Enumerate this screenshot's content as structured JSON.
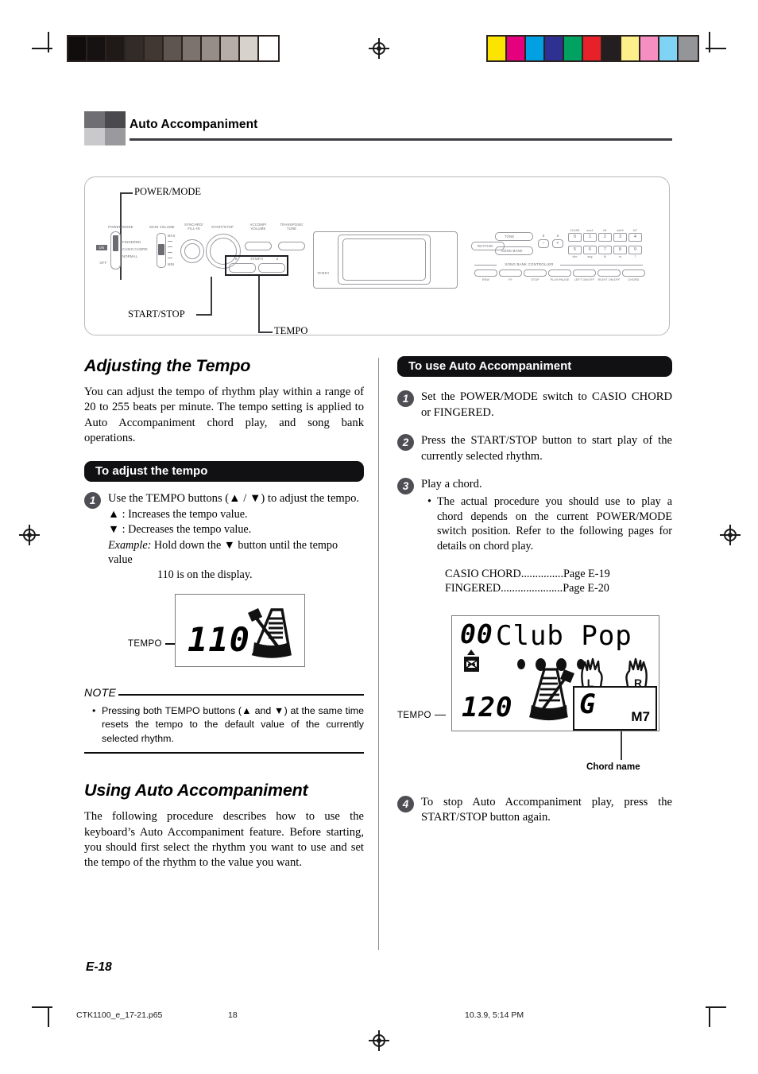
{
  "header": {
    "title": "Auto Accompaniment"
  },
  "panel_figure": {
    "callouts": {
      "power_mode": "POWER/MODE",
      "start_stop": "START/STOP",
      "tempo": "TEMPO"
    },
    "panel_labels": {
      "power_mode": "POWER/MODE",
      "main_volume": "MAIN VOLUME",
      "synchro_fill_in": "SYNCHRO/\nFILL-IN",
      "start_stop": "START/STOP",
      "accomp_volume": "ACCOMP/\nVOLUME",
      "transpose_tune": "TRANSPOSE/\nTUNE",
      "tempo": "TEMPO",
      "tempo_down": "∨",
      "tempo_up": "∧",
      "switch_on": "ON",
      "switch_off": "OFF",
      "mode_fingered": "FINGERED",
      "mode_casio_chord": "CASIO CHORD",
      "mode_normal": "NORMAL",
      "vol_max": "MAX",
      "vol_min": "MIN",
      "lcd_tempo": "TEMPO",
      "rhythm": "RHYTHM",
      "tone": "TONE",
      "song_bank": "SONG BANK",
      "minus": "−",
      "plus": "+",
      "song_bank_controller": "SONG BANK CONTROLLER"
    },
    "numpad_top_labels": [
      "CLEAR",
      "sus4",
      "b5",
      "add9",
      "M7"
    ],
    "numpad_top_keys": [
      "0",
      "1",
      "2",
      "3",
      "4"
    ],
    "numpad_bottom_keys": [
      "5",
      "6",
      "7",
      "8",
      "9"
    ],
    "numpad_bottom_labels": [
      "dim",
      "aug",
      "M",
      "m",
      "7"
    ],
    "controller_buttons": [
      "REW",
      "FF",
      "STOP",
      "PLAY/PAUSE",
      "LEFT ON/OFF",
      "RIGHT ON/OFF",
      "CHORD"
    ]
  },
  "left_column": {
    "heading": "Adjusting the Tempo",
    "intro": "You can adjust the tempo of rhythm play within a range of 20 to 255 beats per minute. The tempo setting is applied to Auto Accompaniment chord play, and song bank operations.",
    "subhead": "To adjust the tempo",
    "step1": {
      "number": "1",
      "text": "Use the TEMPO buttons (▲ / ▼) to adjust the tempo.",
      "line_up": "▲ : Increases the tempo value.",
      "line_down": "▼ : Decreases the tempo value.",
      "example_label": "Example:",
      "example_line1": "Hold down the ▼ button until the tempo value",
      "example_line2": "110 is on the display."
    },
    "tempo_display": {
      "label": "TEMPO",
      "value": "110",
      "icon": "metronome-icon"
    },
    "note": {
      "heading": "NOTE",
      "text": "Pressing both TEMPO buttons (▲ and ▼) at the same time resets the tempo to the default value of the currently selected rhythm."
    },
    "heading2": "Using Auto Accompaniment",
    "intro2": "The following procedure describes how to use the keyboard’s Auto Accompaniment feature. Before starting, you should first select the rhythm you want to use and set the tempo of the rhythm to the value you want."
  },
  "right_column": {
    "subhead": "To use Auto Accompaniment",
    "steps": [
      {
        "number": "1",
        "text": "Set the POWER/MODE switch to CASIO CHORD or FINGERED."
      },
      {
        "number": "2",
        "text": "Press the START/STOP button to start play of the currently selected rhythm."
      },
      {
        "number": "3",
        "text": "Play a chord.",
        "bullet": "The actual procedure you should use to play a chord depends on the current POWER/MODE switch position. Refer to the following pages for details on chord play.",
        "refs": [
          {
            "name": "CASIO CHORD",
            "dots": "...............",
            "page": "Page E-19"
          },
          {
            "name": "FINGERED",
            "dots": "......................",
            "page": "Page E-20"
          }
        ]
      },
      {
        "number": "4",
        "text": "To stop Auto Accompaniment play, press the START/STOP button again."
      }
    ],
    "lcd": {
      "rhythm_number": "00",
      "rhythm_name": "Club Pop",
      "tempo_label": "TEMPO",
      "tempo_value": "120",
      "chord_root": "G",
      "chord_type": "M7",
      "hand_left": "L",
      "hand_right": "R",
      "chord_name_callout": "Chord name",
      "icons": [
        "drum-icon",
        "metronome-icon",
        "beat-dots",
        "left-hand-icon",
        "right-hand-icon"
      ]
    }
  },
  "footer": {
    "folio": "E-18",
    "filename": "CTK1100_e_17-21.p65",
    "page_number": "18",
    "timestamp": "10.3.9, 5:14 PM"
  },
  "registration": {
    "grayscale": [
      "#100d0c",
      "#161211",
      "#1f1a18",
      "#332b28",
      "#413733",
      "#5e5450",
      "#7c726e",
      "#968c88",
      "#b6aca8",
      "#d8d2cc",
      "#ffffff"
    ],
    "colors": [
      "#fbe500",
      "#e5007d",
      "#00a0e2",
      "#2f3192",
      "#00a261",
      "#e6212a",
      "#231f20",
      "#fdf08a",
      "#f58fc2",
      "#7fd3f5",
      "#939598"
    ]
  }
}
